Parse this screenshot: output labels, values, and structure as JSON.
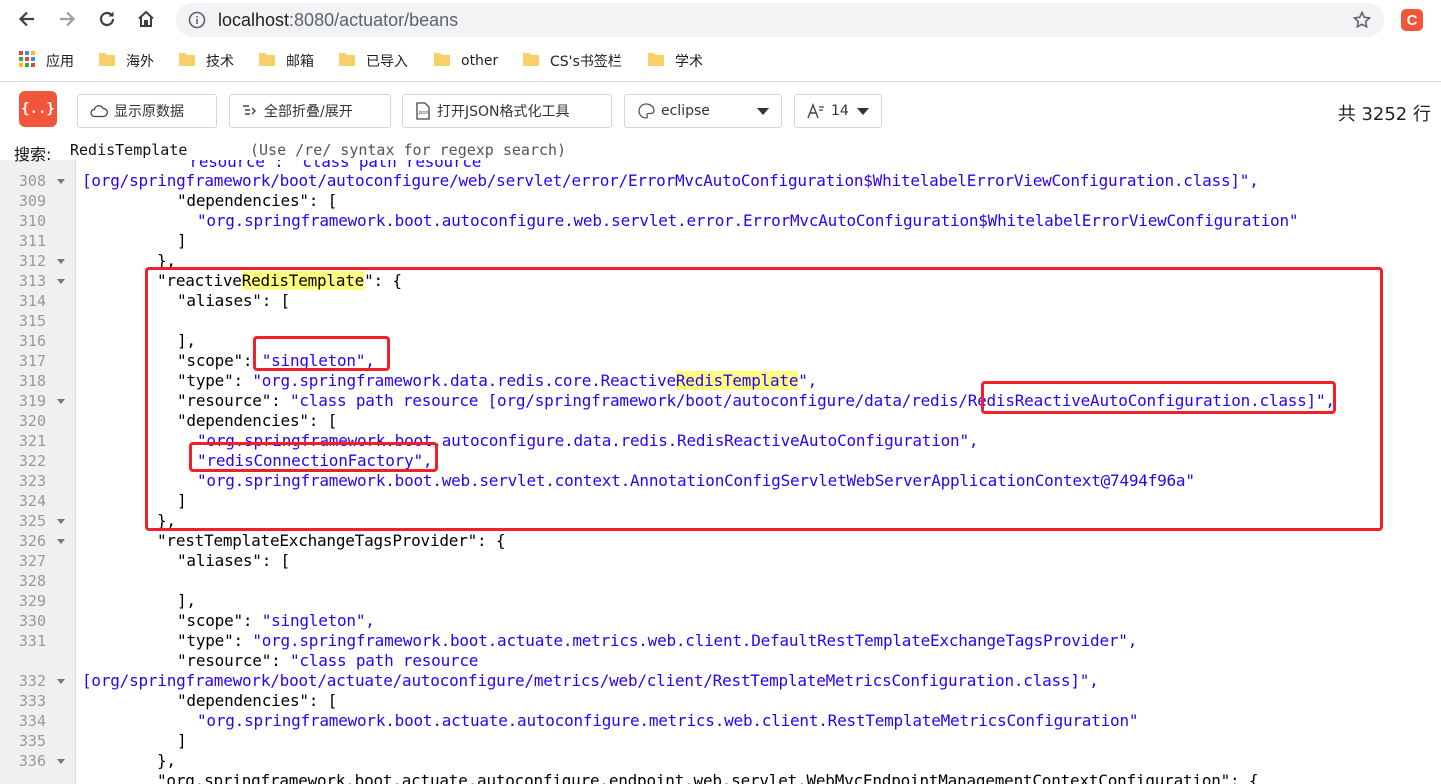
{
  "browser": {
    "url_host": "localhost",
    "url_path": ":8080/actuator/beans",
    "extension_letter": "C",
    "bookmarks": [
      "应用",
      "海外",
      "技术",
      "邮箱",
      "已导入",
      "other",
      "CS's书签栏",
      "学术"
    ]
  },
  "toolbar": {
    "logo_text": "{..}",
    "raw_label": "显示原数据",
    "fold_label": "全部折叠/展开",
    "format_label": "打开JSON格式化工具",
    "theme_value": "eclipse",
    "font_size_value": "14",
    "line_count_prefix": "共",
    "line_count": "3252",
    "line_count_suffix": "行"
  },
  "search": {
    "label": "搜索:",
    "value": "RedisTemplate",
    "hint": "(Use /re/ syntax for regexp search)"
  },
  "code": {
    "top_partial": "\"resource\": \"class path resource",
    "lines": [
      {
        "num": "",
        "fold": false
      },
      {
        "num": "308",
        "fold": true
      },
      {
        "num": "309",
        "fold": false
      },
      {
        "num": "310",
        "fold": false
      },
      {
        "num": "311",
        "fold": false
      },
      {
        "num": "312",
        "fold": true
      },
      {
        "num": "313",
        "fold": true
      },
      {
        "num": "314",
        "fold": false
      },
      {
        "num": "315",
        "fold": false
      },
      {
        "num": "316",
        "fold": false
      },
      {
        "num": "317",
        "fold": false
      },
      {
        "num": "318",
        "fold": false
      },
      {
        "num": "319",
        "fold": true
      },
      {
        "num": "320",
        "fold": false
      },
      {
        "num": "321",
        "fold": false
      },
      {
        "num": "322",
        "fold": false
      },
      {
        "num": "323",
        "fold": false
      },
      {
        "num": "324",
        "fold": false
      },
      {
        "num": "325",
        "fold": true
      },
      {
        "num": "326",
        "fold": true
      },
      {
        "num": "327",
        "fold": false
      },
      {
        "num": "328",
        "fold": false
      },
      {
        "num": "329",
        "fold": false
      },
      {
        "num": "330",
        "fold": false
      },
      {
        "num": "331",
        "fold": false
      },
      {
        "num": "",
        "fold": false
      },
      {
        "num": "332",
        "fold": true
      },
      {
        "num": "333",
        "fold": false
      },
      {
        "num": "334",
        "fold": false
      },
      {
        "num": "335",
        "fold": false
      },
      {
        "num": "336",
        "fold": true
      }
    ],
    "t01": "[org/springframework/boot/autoconfigure/web/servlet/error/ErrorMvcAutoConfiguration$WhitelabelErrorViewConfiguration.class]\",",
    "t02a": "\"dependencies\": [",
    "t03": "\"org.springframework.boot.autoconfigure.web.servlet.error.ErrorMvcAutoConfiguration$WhitelabelErrorViewConfiguration\"",
    "t04": "]",
    "t05": "},",
    "t06_pre": "\"reactive",
    "t06_hl": "RedisTemplate",
    "t06_post": "\": {",
    "t07": "\"aliases\": [",
    "t09": "],",
    "t10_key": "\"scope\": ",
    "t10_val": "\"singleton\",",
    "t11_key": "\"type\": ",
    "t11_val_pre": "\"org.springframework.data.redis.core.Reactive",
    "t11_val_hl": "RedisTemplate",
    "t11_val_post": "\",",
    "t12_key": "\"resource\": ",
    "t12_val": "\"class path resource [org/springframework/boot/autoconfigure/data/redis/RedisReactiveAutoConfiguration.class]\",",
    "t13": "\"dependencies\": [",
    "t14": "\"org.springframework.boot.autoconfigure.data.redis.RedisReactiveAutoConfiguration\",",
    "t15": "\"redisConnectionFactory\",",
    "t16": "\"org.springframework.boot.web.servlet.context.AnnotationConfigServletWebServerApplicationContext@7494f96a\"",
    "t17": "]",
    "t18": "},",
    "t19": "\"restTemplateExchangeTagsProvider\": {",
    "t20": "\"aliases\": [",
    "t22": "],",
    "t23_key": "\"scope\": ",
    "t23_val": "\"singleton\",",
    "t24_key": "\"type\": ",
    "t24_val": "\"org.springframework.boot.actuate.metrics.web.client.DefaultRestTemplateExchangeTagsProvider\",",
    "t25_key": "\"resource\": ",
    "t25_val": "\"class path resource",
    "t26": "[org/springframework/boot/actuate/autoconfigure/metrics/web/client/RestTemplateMetricsConfiguration.class]\",",
    "t27": "\"dependencies\": [",
    "t28": "\"org.springframework.boot.actuate.autoconfigure.metrics.web.client.RestTemplateMetricsConfiguration\"",
    "t29": "]",
    "t30": "},",
    "t31": "\"org.springframework.boot.actuate.autoconfigure.endpoint.web.servlet.WebMvcEndpointManagementContextConfiguration\": {"
  },
  "annotation_color": "#f0202a",
  "highlight_color": "#ffff7f"
}
